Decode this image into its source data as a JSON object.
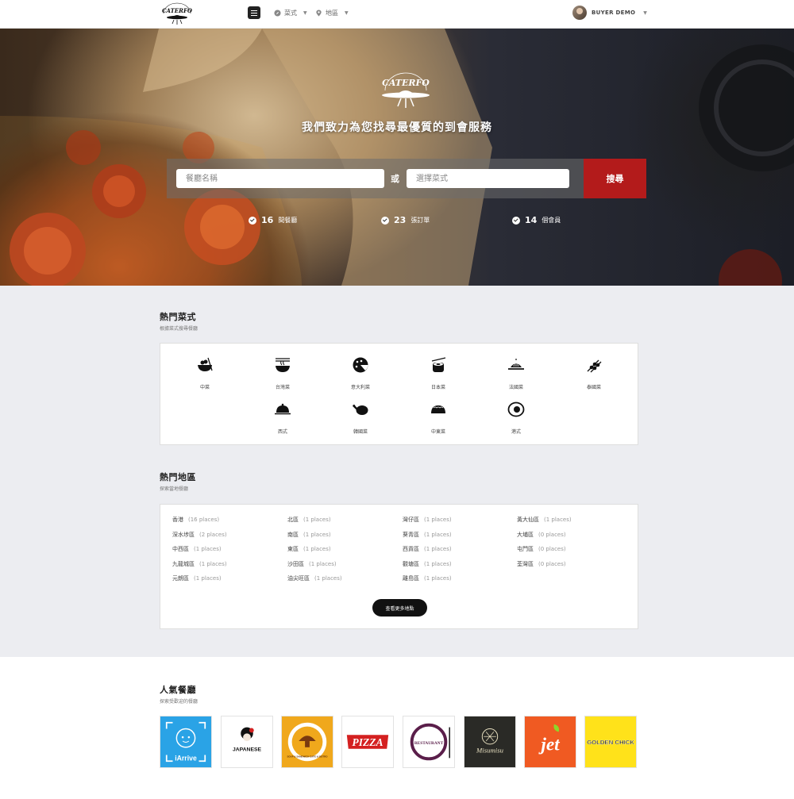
{
  "header": {
    "logo_text": "CATERFO",
    "nav": [
      {
        "label": "菜式",
        "icon": "compass-icon"
      },
      {
        "label": "地區",
        "icon": "map-pin-icon"
      }
    ],
    "user_name": "BUYER DEMO"
  },
  "hero": {
    "logo_text": "CATERFO",
    "tagline": "我們致力為您找尋最優質的到會服務",
    "search": {
      "restaurant_placeholder": "餐廳名稱",
      "or_label": "或",
      "cuisine_placeholder": "選擇菜式",
      "button_label": "搜尋"
    },
    "stats": [
      {
        "value": "16",
        "label": "間餐廳"
      },
      {
        "value": "23",
        "label": "張訂單"
      },
      {
        "value": "14",
        "label": "個會員"
      }
    ]
  },
  "cuisines_section": {
    "title": "熱門菜式",
    "subtitle": "根據菜式搜尋餐廳",
    "items": [
      {
        "label": "中菜",
        "icon": "chinese-bowl-icon"
      },
      {
        "label": "台灣菜",
        "icon": "noodle-bowl-icon"
      },
      {
        "label": "意大利菜",
        "icon": "pizza-icon"
      },
      {
        "label": "日本菜",
        "icon": "sushi-icon"
      },
      {
        "label": "法國菜",
        "icon": "french-dish-icon"
      },
      {
        "label": "泰國菜",
        "icon": "skewer-icon"
      },
      {
        "label": "西式",
        "icon": "cloche-icon"
      },
      {
        "label": "韓國菜",
        "icon": "roast-chicken-icon"
      },
      {
        "label": "中東菜",
        "icon": "taco-icon"
      },
      {
        "label": "港式",
        "icon": "fried-egg-icon"
      }
    ]
  },
  "areas_section": {
    "title": "熱門地區",
    "subtitle": "探索當地餐廳",
    "columns": [
      [
        {
          "name": "香港",
          "count": "(16 places)"
        },
        {
          "name": "深水埗區",
          "count": "(2 places)"
        },
        {
          "name": "中西區",
          "count": "(1 places)"
        },
        {
          "name": "九龍城區",
          "count": "(1 places)"
        },
        {
          "name": "元朗區",
          "count": "(1 places)"
        }
      ],
      [
        {
          "name": "北區",
          "count": "(1 places)"
        },
        {
          "name": "南區",
          "count": "(1 places)"
        },
        {
          "name": "東區",
          "count": "(1 places)"
        },
        {
          "name": "沙田區",
          "count": "(1 places)"
        },
        {
          "name": "油尖旺區",
          "count": "(1 places)"
        }
      ],
      [
        {
          "name": "灣仔區",
          "count": "(1 places)"
        },
        {
          "name": "葵青區",
          "count": "(1 places)"
        },
        {
          "name": "西貢區",
          "count": "(1 places)"
        },
        {
          "name": "觀塘區",
          "count": "(1 places)"
        },
        {
          "name": "離島區",
          "count": "(1 places)"
        }
      ],
      [
        {
          "name": "黃大仙區",
          "count": "(1 places)"
        },
        {
          "name": "大埔區",
          "count": "(0 places)"
        },
        {
          "name": "屯門區",
          "count": "(0 places)"
        },
        {
          "name": "荃灣區",
          "count": "(0 places)"
        }
      ]
    ],
    "more_button": "查看更多地點"
  },
  "restaurants_section": {
    "title": "人氣餐廳",
    "subtitle": "探索受歡迎的餐廳",
    "items": [
      {
        "name": "iArrive",
        "bg": "#2aa3e6",
        "fg": "#ffffff"
      },
      {
        "name": "JAPANESE",
        "bg": "#ffffff",
        "fg": "#111111"
      },
      {
        "name": "SOUP & SANDWICH CAFE & BISTRO",
        "bg": "#f0a81c",
        "fg": "#5a2b0a"
      },
      {
        "name": "PIZZA",
        "bg": "#ffffff",
        "fg": "#d42020"
      },
      {
        "name": "RESTAURANT",
        "bg": "#ffffff",
        "fg": "#5a1e4a"
      },
      {
        "name": "Misumisu",
        "bg": "#2a2a26",
        "fg": "#e8e0c0"
      },
      {
        "name": "jet",
        "bg": "#f05a22",
        "fg": "#ffffff"
      },
      {
        "name": "GOLDEN CHICK",
        "bg": "#ffe21a",
        "fg": "#111111"
      }
    ]
  }
}
